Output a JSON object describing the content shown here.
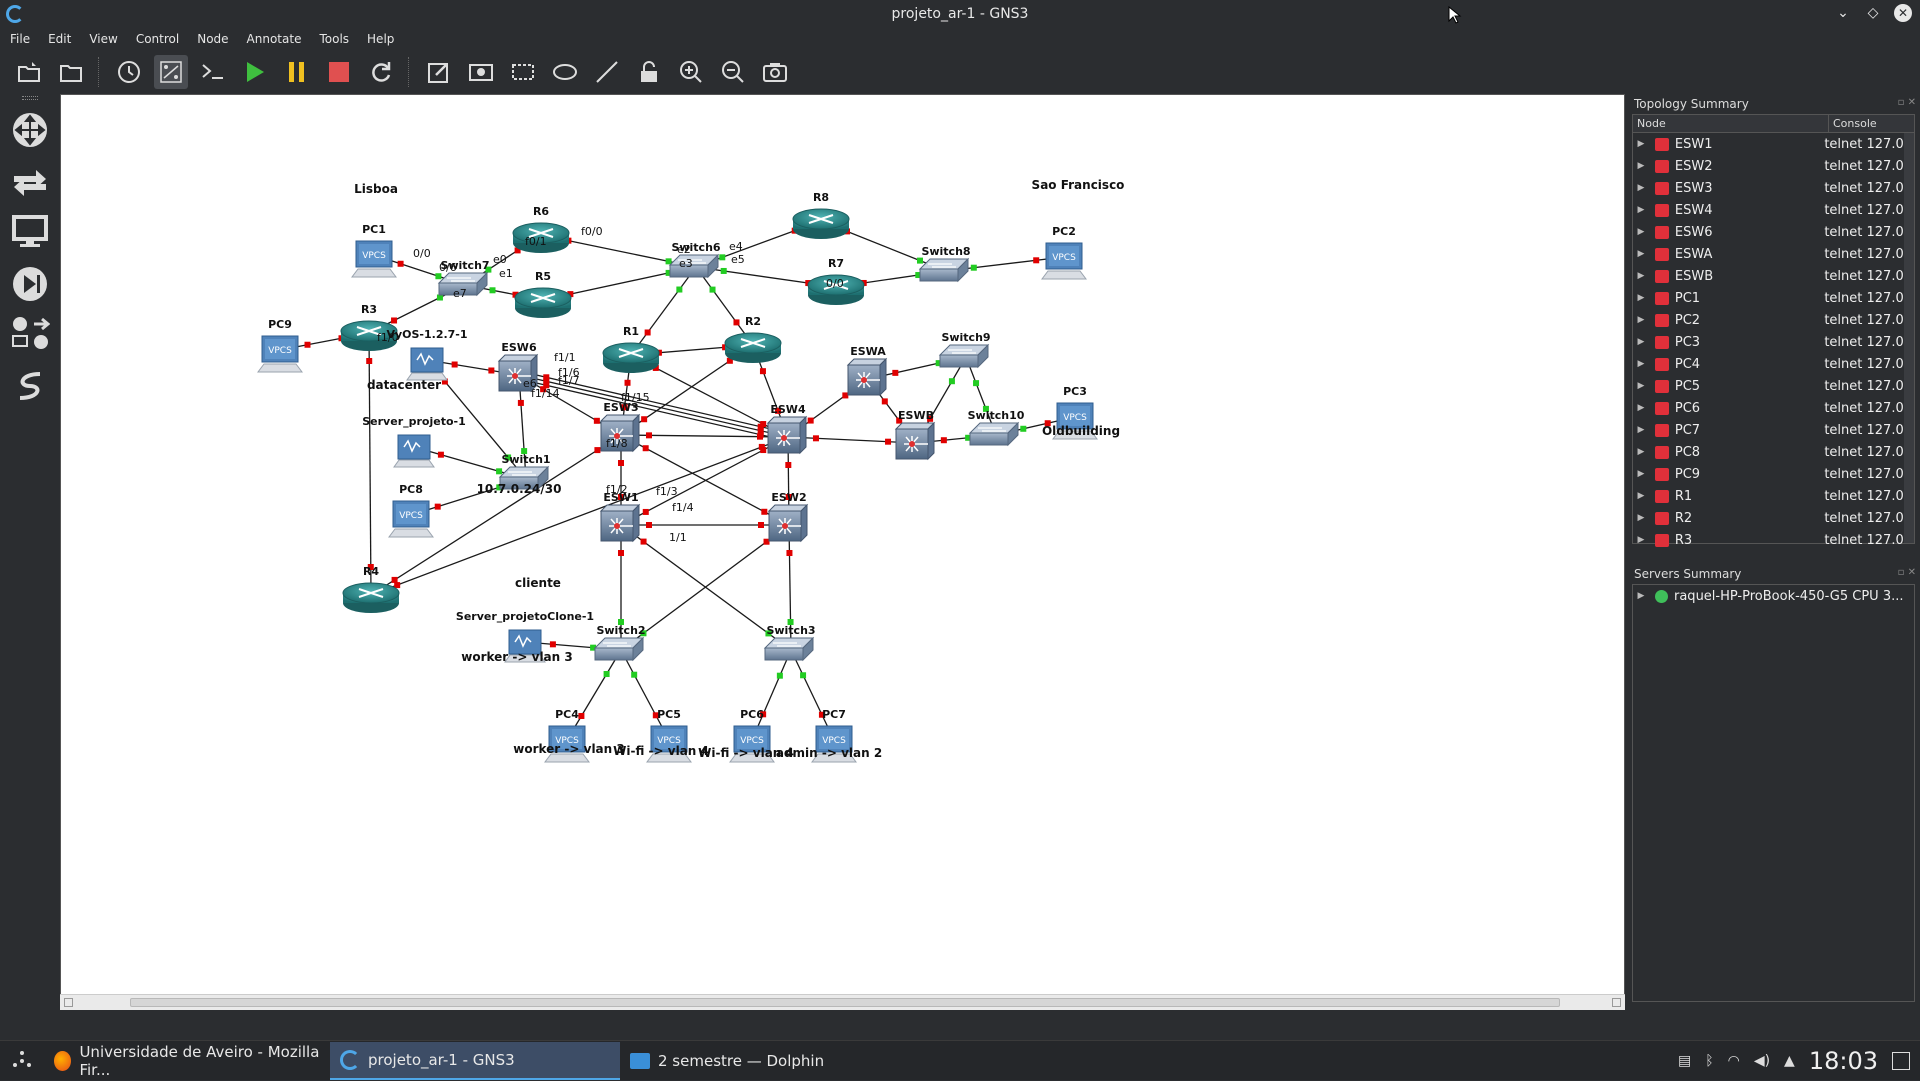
{
  "window": {
    "title": "projeto_ar-1 - GNS3"
  },
  "menu": [
    "File",
    "Edit",
    "View",
    "Control",
    "Node",
    "Annotate",
    "Tools",
    "Help"
  ],
  "toolbar_icons": [
    "open-project-icon",
    "open-folder-icon",
    "snapshot-clock-icon",
    "show-interface-labels-icon",
    "console-all-icon",
    "start-all-icon",
    "pause-all-icon",
    "stop-all-icon",
    "reload-all-icon",
    "add-note-icon",
    "insert-picture-icon",
    "draw-rectangle-icon",
    "draw-ellipse-icon",
    "draw-line-icon",
    "lock-icon",
    "zoom-in-icon",
    "zoom-out-icon",
    "screenshot-icon"
  ],
  "left_icons": [
    "browse-all-devices-icon",
    "browse-routers-icon",
    "browse-end-devices-icon",
    "browse-security-icon",
    "browse-switches-icon",
    "add-link-icon"
  ],
  "topology": {
    "annotations": [
      "Lisboa",
      "Sao Francisco",
      "datacenter",
      "cliente",
      "Oldbuilding",
      "10.7.0.24/30",
      "worker -> vlan 3",
      "worker -> vlan 3",
      "Wi-fi -> vlan 4",
      "Wi-fi -> vlan 4",
      "admin -> vlan 2"
    ],
    "routers": [
      "R6",
      "R5",
      "R8",
      "R7",
      "R3",
      "R1",
      "R2",
      "R4"
    ],
    "switches": [
      "Switch7",
      "Switch6",
      "Switch8",
      "Switch9",
      "Switch10",
      "Switch1",
      "Switch2",
      "Switch3"
    ],
    "multilayer": [
      "ESW6",
      "ESW3",
      "ESW4",
      "ESWA",
      "ESWB",
      "ESW1",
      "ESW2"
    ],
    "pcs": [
      "PC1",
      "PC2",
      "PC3",
      "PC4",
      "PC5",
      "PC6",
      "PC7",
      "PC8",
      "PC9"
    ],
    "hosts": [
      "VyOS-1.2.7-1",
      "Server_projeto-1",
      "Server_projetoClone-1"
    ],
    "vpcs_label": "VPCS",
    "port_labels": [
      "0/0",
      "0/6",
      "e0",
      "e1",
      "e7",
      "f0/1",
      "f0/0",
      "e2",
      "e3",
      "e4",
      "e5",
      "f1/0",
      "f1/1",
      "f1/6",
      "f1/7",
      "f1/8",
      "f1/15",
      "f1/14",
      "f1/2",
      "f1/3",
      "f1/4",
      "1/1",
      "e6"
    ]
  },
  "topology_summary": {
    "title": "Topology Summary",
    "col_node": "Node",
    "col_console": "Console",
    "rows": [
      {
        "name": "ESW1",
        "console": "telnet 127.0"
      },
      {
        "name": "ESW2",
        "console": "telnet 127.0"
      },
      {
        "name": "ESW3",
        "console": "telnet 127.0"
      },
      {
        "name": "ESW4",
        "console": "telnet 127.0"
      },
      {
        "name": "ESW6",
        "console": "telnet 127.0"
      },
      {
        "name": "ESWA",
        "console": "telnet 127.0"
      },
      {
        "name": "ESWB",
        "console": "telnet 127.0"
      },
      {
        "name": "PC1",
        "console": "telnet 127.0"
      },
      {
        "name": "PC2",
        "console": "telnet 127.0"
      },
      {
        "name": "PC3",
        "console": "telnet 127.0"
      },
      {
        "name": "PC4",
        "console": "telnet 127.0"
      },
      {
        "name": "PC5",
        "console": "telnet 127.0"
      },
      {
        "name": "PC6",
        "console": "telnet 127.0"
      },
      {
        "name": "PC7",
        "console": "telnet 127.0"
      },
      {
        "name": "PC8",
        "console": "telnet 127.0"
      },
      {
        "name": "PC9",
        "console": "telnet 127.0"
      },
      {
        "name": "R1",
        "console": "telnet 127.0"
      },
      {
        "name": "R2",
        "console": "telnet 127.0"
      },
      {
        "name": "R3",
        "console": "telnet 127.0"
      }
    ]
  },
  "servers_summary": {
    "title": "Servers Summary",
    "server": "raquel-HP-ProBook-450-G5 CPU 3...",
    "status_color": "#3fbf5a"
  },
  "taskbar": {
    "tasks": [
      {
        "label": "Universidade de Aveiro - Mozilla Fir..."
      },
      {
        "label": "projeto_ar-1 - GNS3"
      },
      {
        "label": "2 semestre — Dolphin"
      }
    ],
    "clock": "18:03"
  },
  "colors": {
    "link": "#1a1a1a",
    "port_down": "#e00000",
    "port_up": "#22cc22",
    "router": "#2a8a8a",
    "taskbar_active": "#3d4d66"
  }
}
